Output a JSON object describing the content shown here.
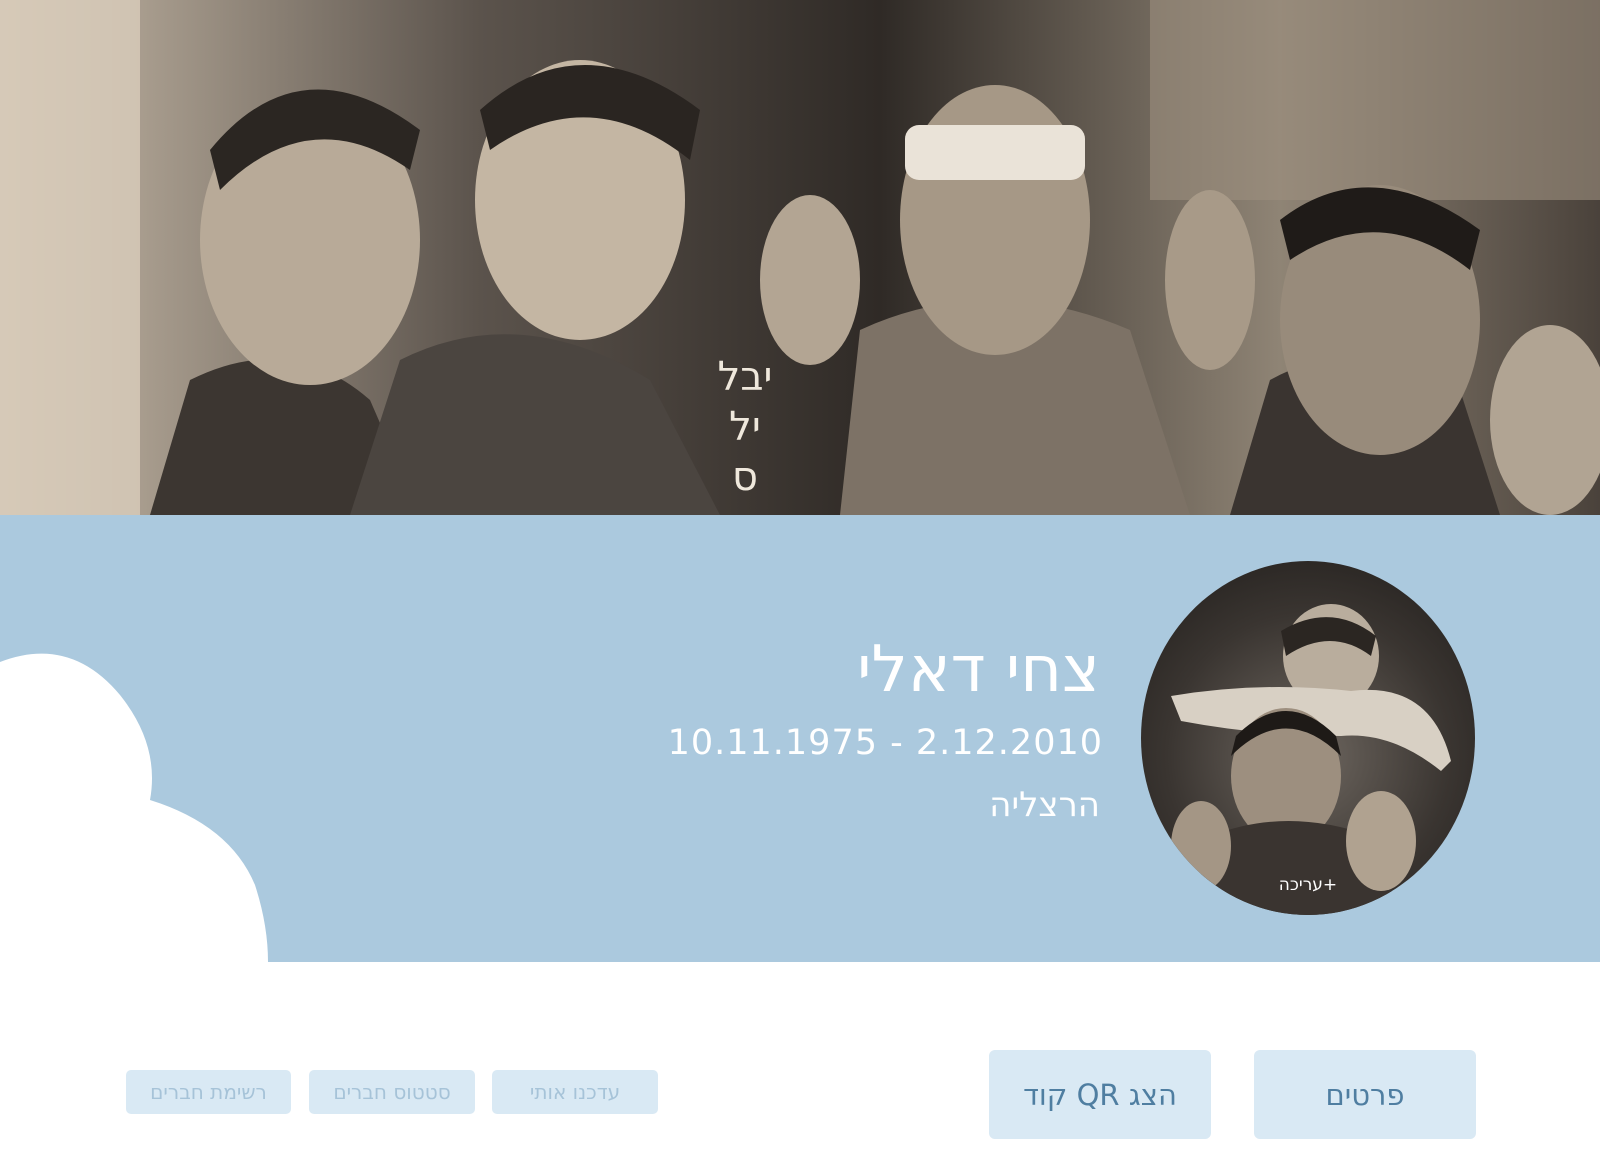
{
  "profile": {
    "name": "צחי דאלי",
    "dates": "10.11.1975 - 2.12.2010",
    "city": "הרצליה",
    "avatar_edit_label": "+עריכה"
  },
  "actions": {
    "details_label": "פרטים",
    "qr_label": "הצג QR קוד",
    "updates_label": "עדכנו אותי",
    "friends_status_label": "סטטוס חברים",
    "friends_list_label": "רשימת חברים"
  },
  "colors": {
    "band": "#abc9de",
    "button_bg": "#d9e9f4",
    "button_text": "#4f7ea1",
    "button_text_muted": "#a6c3d8"
  },
  "images": {
    "cover_photo": "black-and-white group photo of soldiers",
    "cover_photo_lettering": "יבל יל ס",
    "avatar_photo": "black-and-white photo of a young man carrying a child on his shoulders"
  }
}
